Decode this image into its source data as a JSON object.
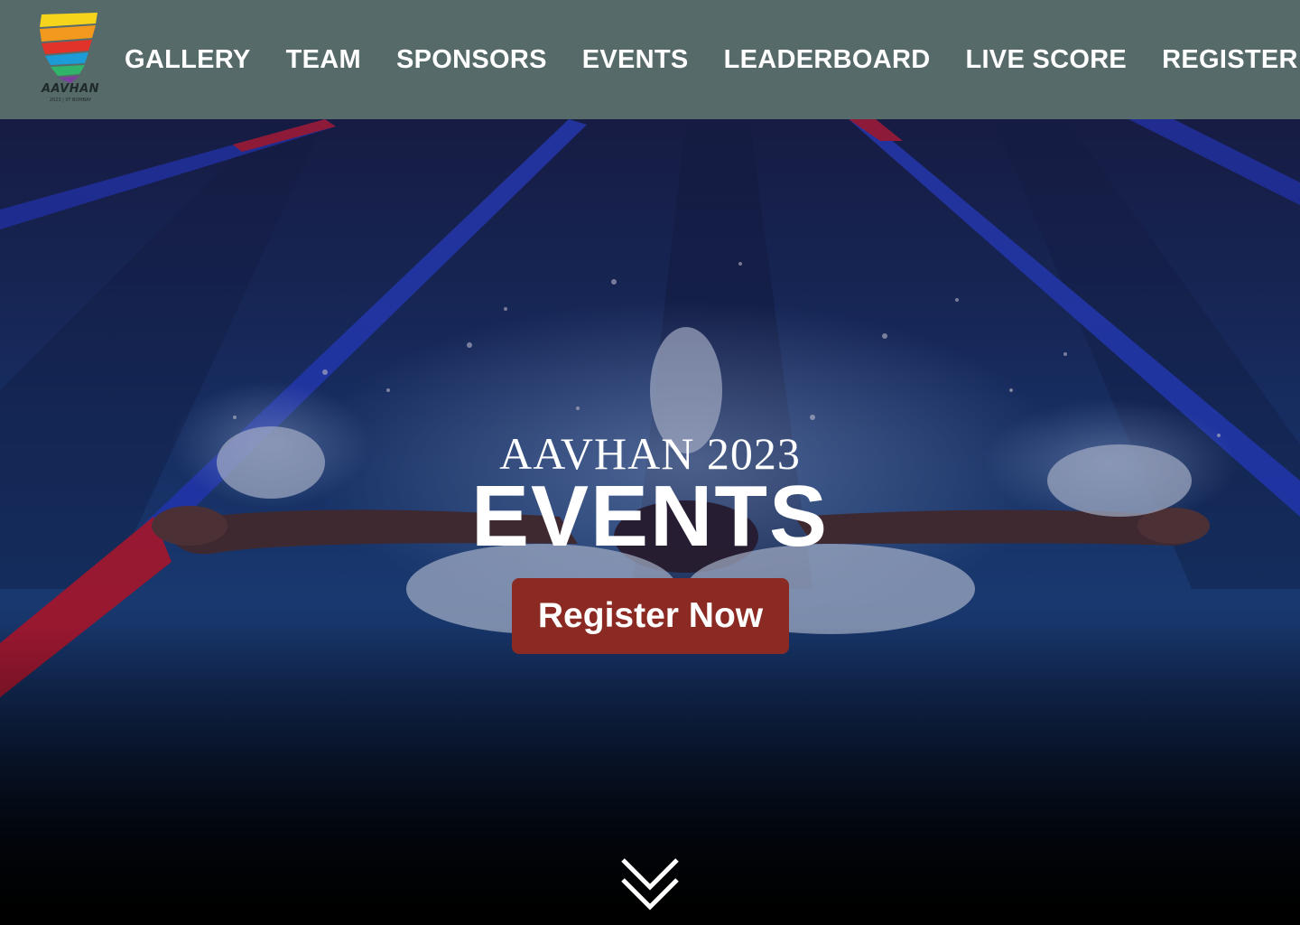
{
  "brand": {
    "logo_text": "AAVHAN",
    "logo_subtext": "2023 | IIT BOMBAY"
  },
  "nav": {
    "items": [
      {
        "label": "GALLERY"
      },
      {
        "label": "TEAM"
      },
      {
        "label": "SPONSORS"
      },
      {
        "label": "EVENTS"
      },
      {
        "label": "LEADERBOARD"
      },
      {
        "label": "LIVE SCORE"
      },
      {
        "label": "REGISTER"
      }
    ]
  },
  "hero": {
    "subtitle": "AAVHAN 2023",
    "title": "EVENTS",
    "cta_label": "Register Now",
    "scroll_icon": "double-chevron-down-icon",
    "background": "swimmer-in-pool-photo"
  },
  "colors": {
    "navbar_bg": "#566a69",
    "cta_bg": "#8a2a23",
    "text": "#ffffff",
    "lane_rope_blue": "#1f3fc4",
    "lane_rope_red": "#c4182a"
  }
}
